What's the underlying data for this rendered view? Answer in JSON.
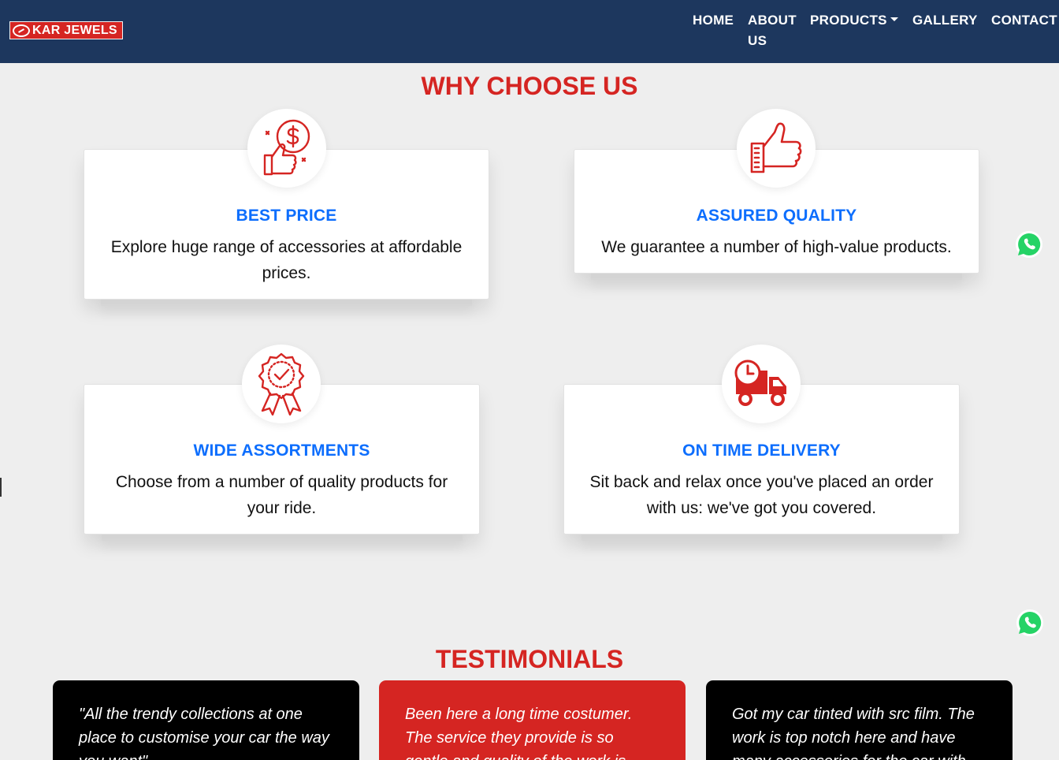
{
  "brand": {
    "name": "KAR JEWELS",
    "tagline": ""
  },
  "nav": {
    "home": "HOME",
    "about_line1": "ABOUT",
    "about_line2": "US",
    "products": "PRODUCTS",
    "gallery": "GALLERY",
    "contact": "CONTACT"
  },
  "why": {
    "title": "WHY CHOOSE US",
    "cards": [
      {
        "title": "BEST PRICE",
        "text": "Explore huge range of accessories at affordable prices.",
        "icon": "dollar-thumbs-up-icon"
      },
      {
        "title": "ASSURED QUALITY",
        "text": "We guarantee a number of high-value products.",
        "icon": "thumbs-up-icon"
      },
      {
        "title": "WIDE ASSORTMENTS",
        "text": "Choose from a number of quality products for your ride.",
        "icon": "badge-check-icon"
      },
      {
        "title": "ON TIME DELIVERY",
        "text": "Sit back and relax once you've placed an order with us: we've got you covered.",
        "icon": "delivery-truck-icon"
      }
    ]
  },
  "testimonials": {
    "title": "TESTIMONIALS",
    "items": [
      {
        "text": "\"All the trendy collections at one place to customise your car the way you want\""
      },
      {
        "text": "Been here a long time costumer. The service they provide is so gentle and quality of the work is amazing. So far"
      },
      {
        "text": "Got my car tinted with src film. The work is top notch here and have many accessories for the car with"
      }
    ]
  },
  "colors": {
    "navbar": "#1d375e",
    "accent_red": "#d52522",
    "title_blue": "#0d6efd",
    "whatsapp": "#25d366"
  }
}
